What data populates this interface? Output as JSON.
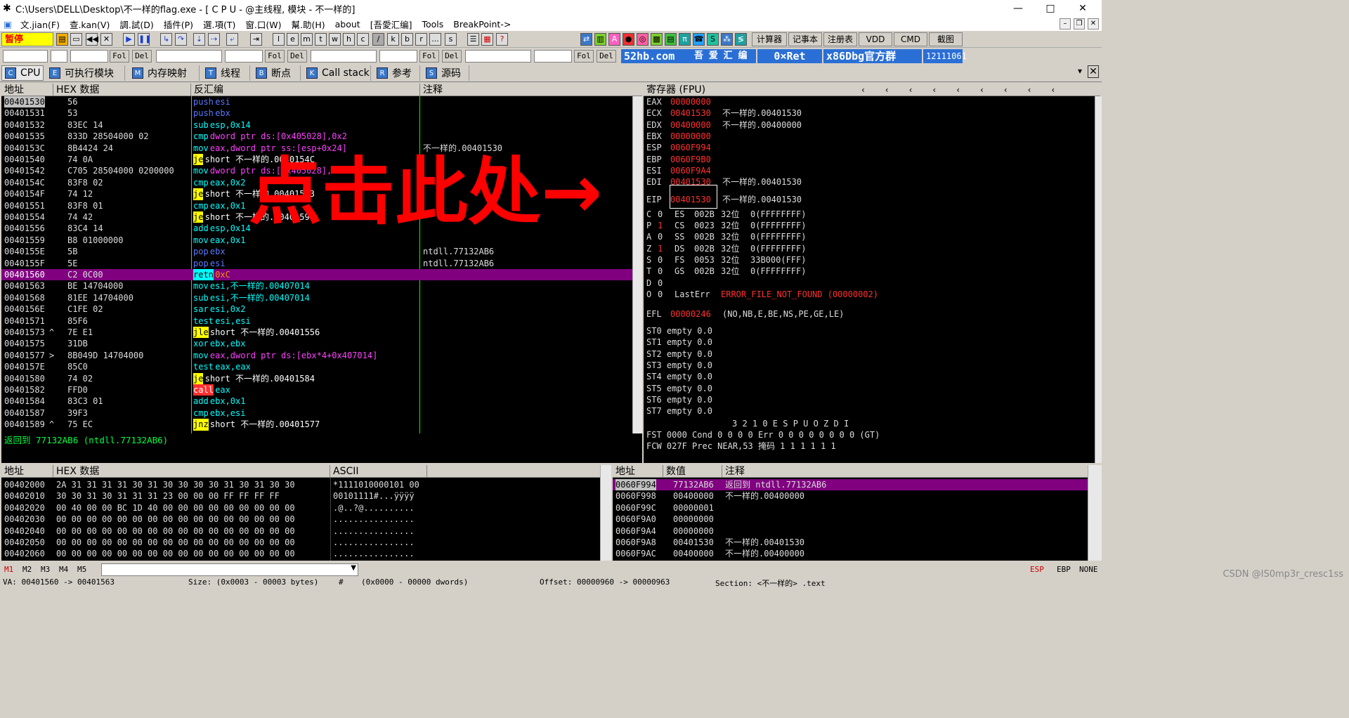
{
  "window": {
    "title": "C:\\Users\\DELL\\Desktop\\不一样的flag.exe - [ C P U  - @主线程, 模块 - 不一样的]",
    "minimize": "—",
    "maximize": "□",
    "close": "✕"
  },
  "menu": [
    "文.jian(F)",
    "查.kan(V)",
    "調.試(D)",
    "插件(P)",
    "選.項(T)",
    "窗.口(W)",
    "幫.助(H)",
    "about",
    "[吾愛汇编]",
    "Tools",
    "BreakPoint->"
  ],
  "toolbar": {
    "pause": "暂停",
    "letters": [
      "l",
      "e",
      "m",
      "t",
      "w",
      "h",
      "c",
      "/",
      "k",
      "b",
      "r",
      "...",
      "s"
    ],
    "right_buttons": [
      "计算器",
      "记事本",
      "注册表",
      "VDD",
      "CMD",
      "截图"
    ]
  },
  "cmdbar": {
    "fol": "Fol",
    "del": "Del",
    "banner1": "52hb.com",
    "banner1b": "吾 爱 汇 编",
    "banner2": "0×Ret",
    "banner3": "x86Dbg官方群",
    "banner4": "12111061"
  },
  "tabs": [
    "CPU",
    "可执行模块",
    "内存映射",
    "线程",
    "断点",
    "Call stack",
    "参考",
    "源码"
  ],
  "disasm": {
    "headers": [
      "地址",
      "HEX 数据",
      "反汇编",
      "注释"
    ],
    "rows": [
      {
        "addr": "00401530",
        "hex": "56",
        "asm": "push esi",
        "cmt": "",
        "mn": "push",
        "ops": "esi",
        "cls": "blue"
      },
      {
        "addr": "00401531",
        "hex": "53",
        "asm": "push ebx",
        "cmt": "",
        "mn": "push",
        "ops": "ebx",
        "cls": "blue"
      },
      {
        "addr": "00401532",
        "hex": "83EC 14",
        "asm": "sub esp,0x14",
        "cmt": "",
        "mn": "sub",
        "ops": "esp,0x14",
        "cls": "cyan"
      },
      {
        "addr": "00401535",
        "hex": "833D 28504000 02",
        "asm": "cmp dword ptr ds:[0x405028],0x2",
        "cmt": "",
        "mn": "cmp",
        "ops": "dword ptr ds:[0x405028],0x2",
        "cls": "cyanmag"
      },
      {
        "addr": "0040153C",
        "hex": "8B4424 24",
        "asm": "mov eax,dword ptr ss:[esp+0x24]",
        "cmt": "不一样的.00401530",
        "mn": "mov",
        "ops": "eax,dword ptr ss:[esp+0x24]",
        "cls": "cyanmag"
      },
      {
        "addr": "00401540",
        "hex": "74 0A",
        "asm": "je short 不一样的.0040154C",
        "cmt": "",
        "mn": "je",
        "ops": "short 不一样的.0040154C",
        "cls": "jmp"
      },
      {
        "addr": "00401542",
        "hex": "C705 28504000 0200000",
        "asm": "mov dword ptr ds:[0x405028],0x2",
        "cmt": "",
        "mn": "mov",
        "ops": "dword ptr ds:[0x405028],0x2",
        "cls": "cyanmag"
      },
      {
        "addr": "0040154C",
        "hex": "83F8 02",
        "asm": "cmp eax,0x2",
        "cmt": "",
        "mn": "cmp",
        "ops": "eax,0x2",
        "cls": "cyan"
      },
      {
        "addr": "0040154F",
        "hex": "74 12",
        "asm": "je short 不一样的.00401563",
        "cmt": "",
        "mn": "je",
        "ops": "short 不一样的.00401563",
        "cls": "jmp"
      },
      {
        "addr": "00401551",
        "hex": "83F8 01",
        "asm": "cmp eax,0x1",
        "cmt": "",
        "mn": "cmp",
        "ops": "eax,0x1",
        "cls": "cyan"
      },
      {
        "addr": "00401554",
        "hex": "74 42",
        "asm": "je short 不一样的.00401598",
        "cmt": "",
        "mn": "je",
        "ops": "short 不一样的.00401598",
        "cls": "jmp"
      },
      {
        "addr": "00401556",
        "hex": "83C4 14",
        "asm": "add esp,0x14",
        "cmt": "",
        "mn": "add",
        "ops": "esp,0x14",
        "cls": "cyan"
      },
      {
        "addr": "00401559",
        "hex": "B8 01000000",
        "asm": "mov eax,0x1",
        "cmt": "",
        "mn": "mov",
        "ops": "eax,0x1",
        "cls": "cyan"
      },
      {
        "addr": "0040155E",
        "hex": "5B",
        "asm": "pop ebx",
        "cmt": "ntdll.77132AB6",
        "mn": "pop",
        "ops": "ebx",
        "cls": "blue"
      },
      {
        "addr": "0040155F",
        "hex": "5E",
        "asm": "pop esi",
        "cmt": "ntdll.77132AB6",
        "mn": "pop",
        "ops": "esi",
        "cls": "blue"
      },
      {
        "addr": "00401560",
        "hex": "C2 0C00",
        "asm": "retn 0xC",
        "cmt": "",
        "mn": "retn",
        "ops": "0xC",
        "cls": "ret"
      },
      {
        "addr": "00401563",
        "hex": "BE 14704000",
        "asm": "mov esi,不一样的.00407014",
        "cmt": "",
        "mn": "mov",
        "ops": "esi,不一样的.00407014",
        "cls": "cyan"
      },
      {
        "addr": "00401568",
        "hex": "81EE 14704000",
        "asm": "sub esi,不一样的.00407014",
        "cmt": "",
        "mn": "sub",
        "ops": "esi,不一样的.00407014",
        "cls": "cyan"
      },
      {
        "addr": "0040156E",
        "hex": "C1FE 02",
        "asm": "sar esi,0x2",
        "cmt": "",
        "mn": "sar",
        "ops": "esi,0x2",
        "cls": "cyan"
      },
      {
        "addr": "00401571",
        "hex": "85F6",
        "asm": "test esi,esi",
        "cmt": "",
        "mn": "test",
        "ops": "esi,esi",
        "cls": "cyan"
      },
      {
        "addr": "00401573",
        "hex": "7E E1",
        "asm": "jle short 不一样的.00401556",
        "cmt": "",
        "mn": "jle",
        "ops": "short 不一样的.00401556",
        "cls": "jmp",
        "mark": "^"
      },
      {
        "addr": "00401575",
        "hex": "31DB",
        "asm": "xor ebx,ebx",
        "cmt": "",
        "mn": "xor",
        "ops": "ebx,ebx",
        "cls": "cyan"
      },
      {
        "addr": "00401577",
        "hex": "8B049D 14704000",
        "asm": "mov eax,dword ptr ds:[ebx*4+0x407014]",
        "cmt": "",
        "mn": "mov",
        "ops": "eax,dword ptr ds:[ebx*4+0x407014]",
        "cls": "cyanmag",
        "mark": ">"
      },
      {
        "addr": "0040157E",
        "hex": "85C0",
        "asm": "test eax,eax",
        "cmt": "",
        "mn": "test",
        "ops": "eax,eax",
        "cls": "cyan"
      },
      {
        "addr": "00401580",
        "hex": "74 02",
        "asm": "je short 不一样的.00401584",
        "cmt": "",
        "mn": "je",
        "ops": "short 不一样的.00401584",
        "cls": "jmp"
      },
      {
        "addr": "00401582",
        "hex": "FFD0",
        "asm": "call eax",
        "cmt": "",
        "mn": "call",
        "ops": "eax",
        "cls": "call"
      },
      {
        "addr": "00401584",
        "hex": "83C3 01",
        "asm": "add ebx,0x1",
        "cmt": "",
        "mn": "add",
        "ops": "ebx,0x1",
        "cls": "cyan"
      },
      {
        "addr": "00401587",
        "hex": "39F3",
        "asm": "cmp ebx,esi",
        "cmt": "",
        "mn": "cmp",
        "ops": "ebx,esi",
        "cls": "cyan"
      },
      {
        "addr": "00401589",
        "hex": "75 EC",
        "asm": "jnz short 不一样的.00401577",
        "cmt": "",
        "mn": "jnz",
        "ops": "short 不一样的.00401577",
        "cls": "jmp",
        "mark": "^"
      }
    ],
    "info_line": "返回到 77132AB6 (ntdll.77132AB6)"
  },
  "registers": {
    "header": "寄存器 (FPU)",
    "rows": [
      {
        "name": "EAX",
        "val": "00000000",
        "cmt": ""
      },
      {
        "name": "ECX",
        "val": "00401530",
        "cmt": "不一样的.00401530"
      },
      {
        "name": "EDX",
        "val": "00400000",
        "cmt": "不一样的.00400000"
      },
      {
        "name": "EBX",
        "val": "00000000",
        "cmt": ""
      },
      {
        "name": "ESP",
        "val": "0060F994",
        "cmt": ""
      },
      {
        "name": "EBP",
        "val": "0060F9B0",
        "cmt": ""
      },
      {
        "name": "ESI",
        "val": "0060F9A4",
        "cmt": ""
      },
      {
        "name": "EDI",
        "val": "00401530",
        "cmt": "不一样的.00401530"
      }
    ],
    "eip": {
      "name": "EIP",
      "val": "00401530",
      "cmt": "不一样的.00401530"
    },
    "segs": [
      {
        "flag": "C",
        "fv": "0",
        "seg": "ES",
        "sv": "002B",
        "bits": "32位",
        "range": "0(FFFFFFFF)"
      },
      {
        "flag": "P",
        "fv": "1",
        "seg": "CS",
        "sv": "0023",
        "bits": "32位",
        "range": "0(FFFFFFFF)"
      },
      {
        "flag": "A",
        "fv": "0",
        "seg": "SS",
        "sv": "002B",
        "bits": "32位",
        "range": "0(FFFFFFFF)"
      },
      {
        "flag": "Z",
        "fv": "1",
        "seg": "DS",
        "sv": "002B",
        "bits": "32位",
        "range": "0(FFFFFFFF)"
      },
      {
        "flag": "S",
        "fv": "0",
        "seg": "FS",
        "sv": "0053",
        "bits": "32位",
        "range": "33B000(FFF)"
      },
      {
        "flag": "T",
        "fv": "0",
        "seg": "GS",
        "sv": "002B",
        "bits": "32位",
        "range": "0(FFFFFFFF)"
      },
      {
        "flag": "D",
        "fv": "0",
        "seg": "",
        "sv": "",
        "bits": "",
        "range": ""
      },
      {
        "flag": "O",
        "fv": "0",
        "seg": "LastErr",
        "sv": "",
        "bits": "",
        "range": ""
      }
    ],
    "lasterr": "ERROR_FILE_NOT_FOUND (00000002)",
    "efl_label": "EFL",
    "efl_val": "00000246",
    "efl_flags": "(NO,NB,E,BE,NS,PE,GE,LE)",
    "st": [
      "ST0 empty 0.0",
      "ST1 empty 0.0",
      "ST2 empty 0.0",
      "ST3 empty 0.0",
      "ST4 empty 0.0",
      "ST5 empty 0.0",
      "ST6 empty 0.0",
      "ST7 empty 0.0"
    ],
    "fst_hdr": "3 2 1 0      E S P U O Z D I",
    "fst": "FST 0000  Cond 0 0 0 0  Err 0 0 0 0 0 0 0 0  (GT)",
    "fcw": "FCW 027F  Prec NEAR,53  掩码    1 1 1 1 1 1"
  },
  "dump": {
    "headers": [
      "地址",
      "HEX 数据",
      "ASCII"
    ],
    "rows": [
      {
        "addr": "00402000",
        "hex": "2A 31 31 31 31 30 31 30 30 30 30 31 30 31 30 30",
        "ascii": "*1111010000101 00"
      },
      {
        "addr": "00402010",
        "hex": "30 30 31 30 31 31 31 23 00 00 00 FF FF FF FF",
        "ascii": "00101111#...ÿÿÿÿ"
      },
      {
        "addr": "00402020",
        "hex": "00 40 00 00 BC 1D 40 00 00 00 00 00 00 00 00 00",
        "ascii": ".@..?@.........."
      },
      {
        "addr": "00402030",
        "hex": "00 00 00 00 00 00 00 00 00 00 00 00 00 00 00 00",
        "ascii": "................"
      },
      {
        "addr": "00402040",
        "hex": "00 00 00 00 00 00 00 00 00 00 00 00 00 00 00 00",
        "ascii": "................"
      },
      {
        "addr": "00402050",
        "hex": "00 00 00 00 00 00 00 00 00 00 00 00 00 00 00 00",
        "ascii": "................"
      },
      {
        "addr": "00402060",
        "hex": "00 00 00 00 00 00 00 00 00 00 00 00 00 00 00 00",
        "ascii": "................"
      }
    ]
  },
  "stack": {
    "headers": [
      "地址",
      "数值",
      "注释"
    ],
    "rows": [
      {
        "addr": "0060F994",
        "val": "77132AB6",
        "cmt": "返回到 ntdll.77132AB6"
      },
      {
        "addr": "0060F998",
        "val": "00400000",
        "cmt": "不一样的.00400000"
      },
      {
        "addr": "0060F99C",
        "val": "00000001",
        "cmt": ""
      },
      {
        "addr": "0060F9A0",
        "val": "00000000",
        "cmt": ""
      },
      {
        "addr": "0060F9A4",
        "val": "00000000",
        "cmt": ""
      },
      {
        "addr": "0060F9A8",
        "val": "00401530",
        "cmt": "不一样的.00401530"
      },
      {
        "addr": "0060F9AC",
        "val": "00400000",
        "cmt": "不一样的.00400000"
      }
    ]
  },
  "statusbar": {
    "marks": [
      "M1",
      "M2",
      "M3",
      "M4",
      "M5"
    ],
    "right": [
      "ESP",
      "EBP",
      "NONE"
    ]
  },
  "infobar": {
    "va": "VA: 00401560 -> 00401563",
    "size": "Size: (0x0003 - 00003 bytes)",
    "hash": "#",
    "dwords": "(0x0000 - 00000 dwords)",
    "offset": "Offset: 00000960 -> 00000963",
    "section": "Section: <不一样的> .text"
  },
  "annotation": {
    "text": "点击此处→"
  },
  "watermark": "CSDN @IS0mp3r_cresc1ss"
}
